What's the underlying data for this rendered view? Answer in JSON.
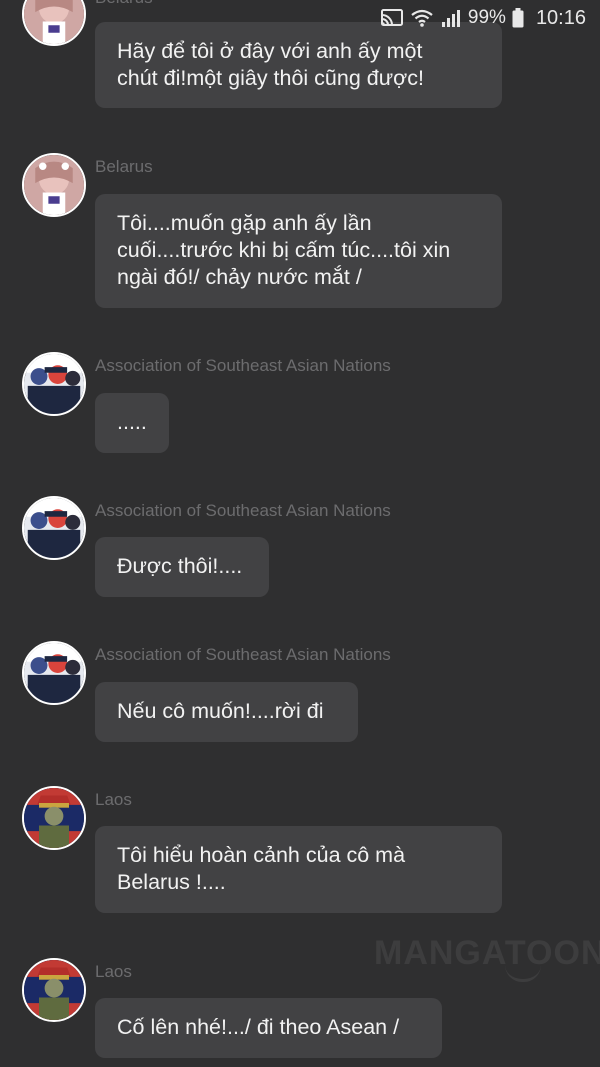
{
  "status_bar": {
    "cast_icon": "cast-icon",
    "wifi_icon": "wifi-icon",
    "signal_icon": "signal-icon",
    "battery_percent": "99%",
    "battery_icon": "battery-icon",
    "time": "10:16"
  },
  "messages": [
    {
      "sender": "Belarus",
      "avatar": "belarus-avatar",
      "text": "Hãy để tôi ở đây với anh ấy một\nchút đi!một giây thôi cũng được!"
    },
    {
      "sender": "Belarus",
      "avatar": "belarus-avatar",
      "text": "Tôi....muốn gặp anh ấy lần\ncuối....trước khi bị cấm túc....tôi xin\nngài đó!/ chảy nước mắt /"
    },
    {
      "sender": "Association of Southeast Asian Nations",
      "avatar": "asean-avatar",
      "text": "....."
    },
    {
      "sender": "Association of Southeast Asian Nations",
      "avatar": "asean-avatar",
      "text": "Được thôi!...."
    },
    {
      "sender": "Association of Southeast Asian Nations",
      "avatar": "asean-avatar",
      "text": "Nếu cô muốn!....rời đi"
    },
    {
      "sender": "Laos",
      "avatar": "laos-avatar",
      "text": "Tôi hiểu hoàn cảnh của cô mà\nBelarus !...."
    },
    {
      "sender": "Laos",
      "avatar": "laos-avatar",
      "text": "Cố lên nhé!.../ đi theo Asean /"
    }
  ],
  "watermark": "MANGATOON",
  "colors": {
    "background": "#2f2f30",
    "bubble": "#424244",
    "sender_text": "#6c6c6e",
    "message_text": "#f2f2f2"
  }
}
